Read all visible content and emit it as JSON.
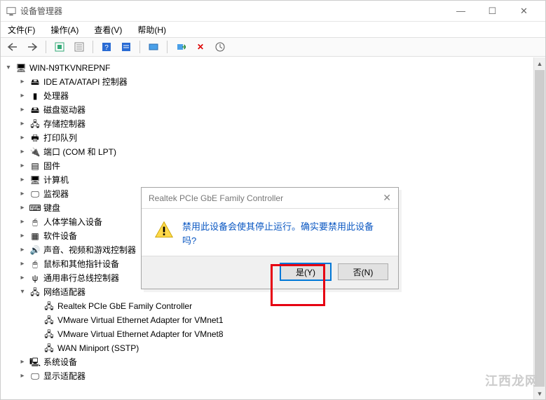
{
  "window": {
    "title": "设备管理器",
    "controls": {
      "min": "—",
      "max": "☐",
      "close": "✕"
    }
  },
  "menu": {
    "file": "文件(F)",
    "action": "操作(A)",
    "view": "查看(V)",
    "help": "帮助(H)"
  },
  "tree": {
    "root": "WIN-N9TKVNREPNF",
    "categories": [
      {
        "label": "IDE ATA/ATAPI 控制器",
        "icon": "🖴"
      },
      {
        "label": "处理器",
        "icon": "▮"
      },
      {
        "label": "磁盘驱动器",
        "icon": "🖴"
      },
      {
        "label": "存储控制器",
        "icon": "🖧"
      },
      {
        "label": "打印队列",
        "icon": "🖶"
      },
      {
        "label": "端口 (COM 和 LPT)",
        "icon": "🔌"
      },
      {
        "label": "固件",
        "icon": "▤"
      },
      {
        "label": "计算机",
        "icon": "🖥"
      },
      {
        "label": "监视器",
        "icon": "🖵"
      },
      {
        "label": "键盘",
        "icon": "⌨"
      },
      {
        "label": "人体学输入设备",
        "icon": "🖱"
      },
      {
        "label": "软件设备",
        "icon": "▦"
      },
      {
        "label": "声音、视频和游戏控制器",
        "icon": "🔊"
      },
      {
        "label": "鼠标和其他指针设备",
        "icon": "🖱"
      },
      {
        "label": "通用串行总线控制器",
        "icon": "ψ"
      }
    ],
    "network": {
      "label": "网络适配器",
      "icon": "🖧",
      "children": [
        "Realtek PCIe GbE Family Controller",
        "VMware Virtual Ethernet Adapter for VMnet1",
        "VMware Virtual Ethernet Adapter for VMnet8",
        "WAN Miniport (SSTP)"
      ]
    },
    "after": [
      {
        "label": "系统设备",
        "icon": "🖳"
      },
      {
        "label": "显示适配器",
        "icon": "🖵"
      }
    ]
  },
  "dialog": {
    "title": "Realtek PCIe GbE Family Controller",
    "message": "禁用此设备会使其停止运行。确实要禁用此设备吗?",
    "yes": "是(Y)",
    "no": "否(N)"
  },
  "watermark": "江西龙网",
  "scroll": {
    "up": "▲",
    "down": "▼"
  }
}
